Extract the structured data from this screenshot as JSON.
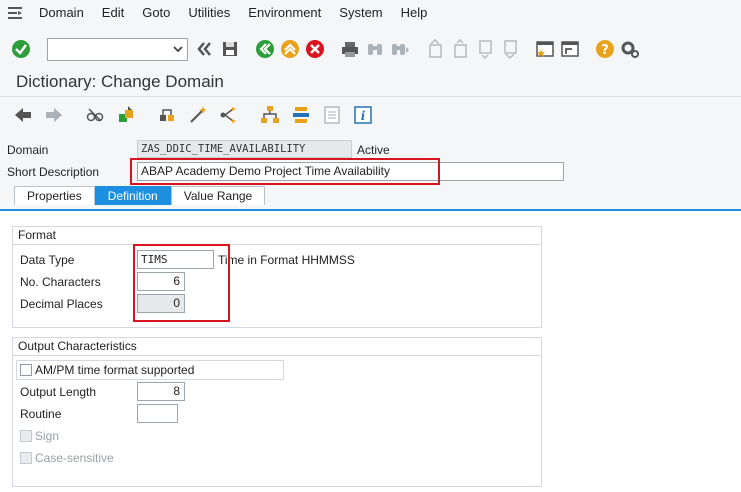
{
  "menu": {
    "items": [
      "Domain",
      "Edit",
      "Goto",
      "Utilities",
      "Environment",
      "System",
      "Help"
    ]
  },
  "toolbar": {
    "command_field_value": "",
    "icons": [
      "enter-icon",
      "back-double-icon",
      "save-icon",
      "back-icon",
      "exit-icon",
      "cancel-icon",
      "print-icon",
      "find-icon",
      "find-next-icon",
      "first-page-icon",
      "previous-page-icon",
      "next-page-icon",
      "last-page-icon",
      "new-session-icon",
      "shortcut-icon",
      "help-icon",
      "customize-layout-icon"
    ]
  },
  "page": {
    "title": "Dictionary: Change Domain"
  },
  "header": {
    "domain_label": "Domain",
    "domain_value": "ZAS_DDIC_TIME_AVAILABILITY",
    "status": "Active",
    "short_desc_label": "Short Description",
    "short_desc_value": "ABAP Academy Demo Project Time Availability"
  },
  "tabs": [
    {
      "label": "Properties",
      "active": false
    },
    {
      "label": "Definition",
      "active": true
    },
    {
      "label": "Value Range",
      "active": false
    }
  ],
  "format": {
    "title": "Format",
    "data_type_label": "Data Type",
    "data_type_value": "TIMS",
    "data_type_desc": "Time in Format HHMMSS",
    "no_chars_label": "No. Characters",
    "no_chars_value": "6",
    "decimal_label": "Decimal Places",
    "decimal_value": "0"
  },
  "output": {
    "title": "Output Characteristics",
    "ampm_label": "AM/PM time format supported",
    "output_length_label": "Output Length",
    "output_length_value": "8",
    "routine_label": "Routine",
    "routine_value": "",
    "sign_label": "Sign",
    "case_label": "Case-sensitive"
  },
  "colors": {
    "accent": "#1c8fe0",
    "highlight": "#d9141e"
  }
}
